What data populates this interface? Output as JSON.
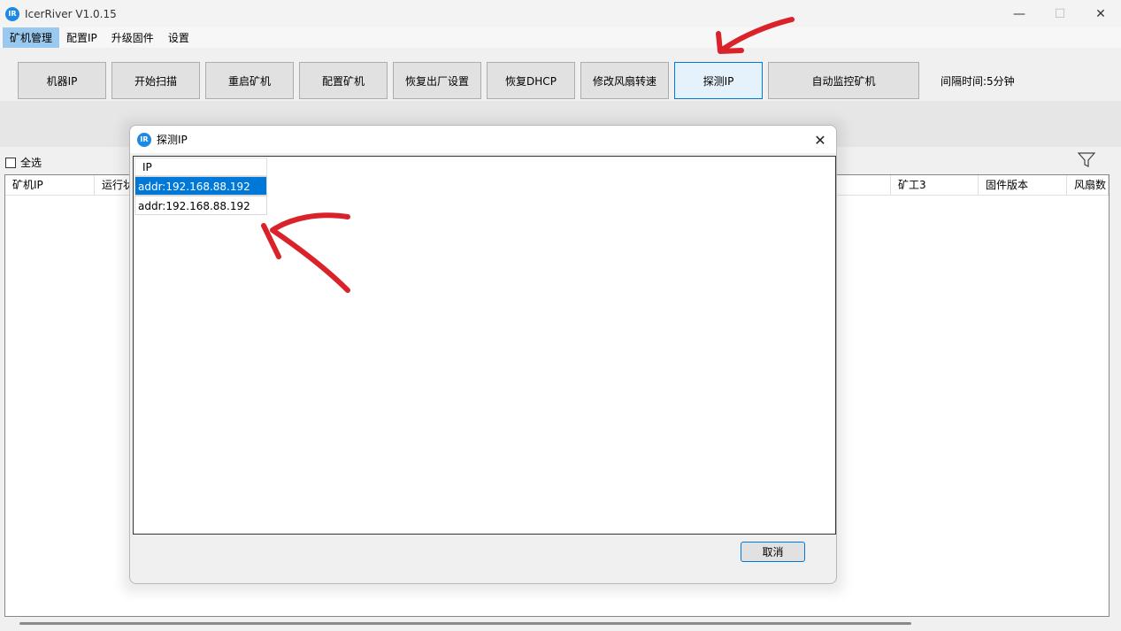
{
  "window": {
    "title": "IcerRiver V1.0.15",
    "logo_text": "IR",
    "minimize": "—",
    "maximize": "☐",
    "close": "✕"
  },
  "menu": {
    "items": [
      "矿机管理",
      "配置IP",
      "升级固件",
      "设置"
    ]
  },
  "toolbar": {
    "buttons": [
      "机器IP",
      "开始扫描",
      "重启矿机",
      "配置矿机",
      "恢复出厂设置",
      "恢复DHCP",
      "修改风扇转速",
      "探测IP",
      "自动监控矿机"
    ],
    "interval_label": "间隔时间:5分钟"
  },
  "select_all": {
    "label": "全选"
  },
  "grid": {
    "columns": [
      "矿机IP",
      "运行状",
      "矿工3",
      "固件版本",
      "风扇数"
    ]
  },
  "dialog": {
    "logo_text": "IR",
    "title": "探测IP",
    "close": "✕",
    "list_header": "IP",
    "rows": [
      "addr:192.168.88.192",
      "addr:192.168.88.192"
    ],
    "cancel_label": "取消"
  },
  "colors": {
    "accent": "#0078d7",
    "menu_active": "#99c9ef",
    "annotation_arrow": "#d9222a"
  }
}
